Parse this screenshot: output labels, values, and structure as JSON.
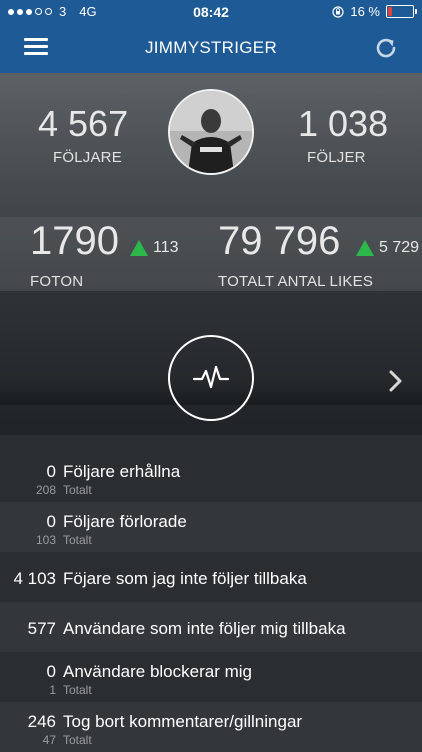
{
  "status_bar": {
    "carrier": "3",
    "network": "4G",
    "time": "08:42",
    "battery_percent": "16 %",
    "battery_level": 0.16
  },
  "nav": {
    "title": "JIMMYSTRIGER"
  },
  "stats": {
    "followers": {
      "value": "4 567",
      "label": "FÖLJARE"
    },
    "following": {
      "value": "1 038",
      "label": "FÖLJER"
    },
    "photos": {
      "value": "1790",
      "delta": "113",
      "label": "FOTON"
    },
    "likes": {
      "value": "79 796",
      "delta": "5 729",
      "label": "TOTALT ANTAL LIKES"
    }
  },
  "colors": {
    "nav_bar": "#1e5a96",
    "up_arrow": "#2db84b",
    "battery_low": "#e0423b"
  },
  "list": [
    {
      "num": "0",
      "title": "Följare erhållna",
      "subnum": "208",
      "sublabel": "Totalt"
    },
    {
      "num": "0",
      "title": "Följare förlorade",
      "subnum": "103",
      "sublabel": "Totalt"
    },
    {
      "num": "4 103",
      "title": "Föjare som jag inte följer tillbaka"
    },
    {
      "num": "577",
      "title": "Användare som inte följer mig tillbaka"
    },
    {
      "num": "0",
      "title": "Användare blockerar mig",
      "subnum": "1",
      "sublabel": "Totalt"
    },
    {
      "num": "246",
      "title": "Tog bort kommentarer/gillningar",
      "subnum": "47",
      "sublabel": "Totalt"
    }
  ]
}
